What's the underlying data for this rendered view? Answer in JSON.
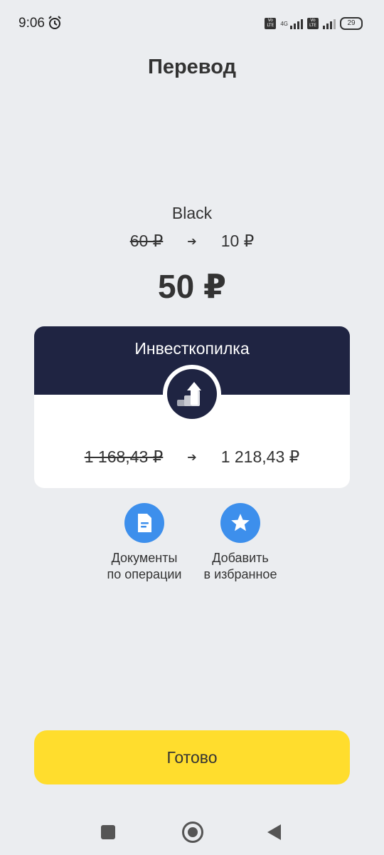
{
  "status_bar": {
    "time": "9:06",
    "alarm_icon": "alarm-clock-icon",
    "volte1": "Vo LTE",
    "network": "4G",
    "volte2": "Vo LTE",
    "battery": "29"
  },
  "header": {
    "title": "Перевод"
  },
  "source_account": {
    "name": "Black",
    "balance_before": "60 ₽",
    "balance_after": "10 ₽"
  },
  "amount": "50 ₽",
  "target_card": {
    "title": "Инвесткопилка",
    "icon": "growth-arrow-icon",
    "balance_before": "1 168,43 ₽",
    "balance_after": "1 218,43 ₽",
    "header_color": "#1f2442"
  },
  "actions": {
    "documents": {
      "line1": "Документы",
      "line2": "по операции",
      "icon": "document-icon"
    },
    "favorite": {
      "line1": "Добавить",
      "line2": "в избранное",
      "icon": "star-icon"
    }
  },
  "done_button": {
    "label": "Готово",
    "color": "#ffdd2d"
  },
  "arrow_glyph": "➔",
  "accent_color": "#3d8fec"
}
